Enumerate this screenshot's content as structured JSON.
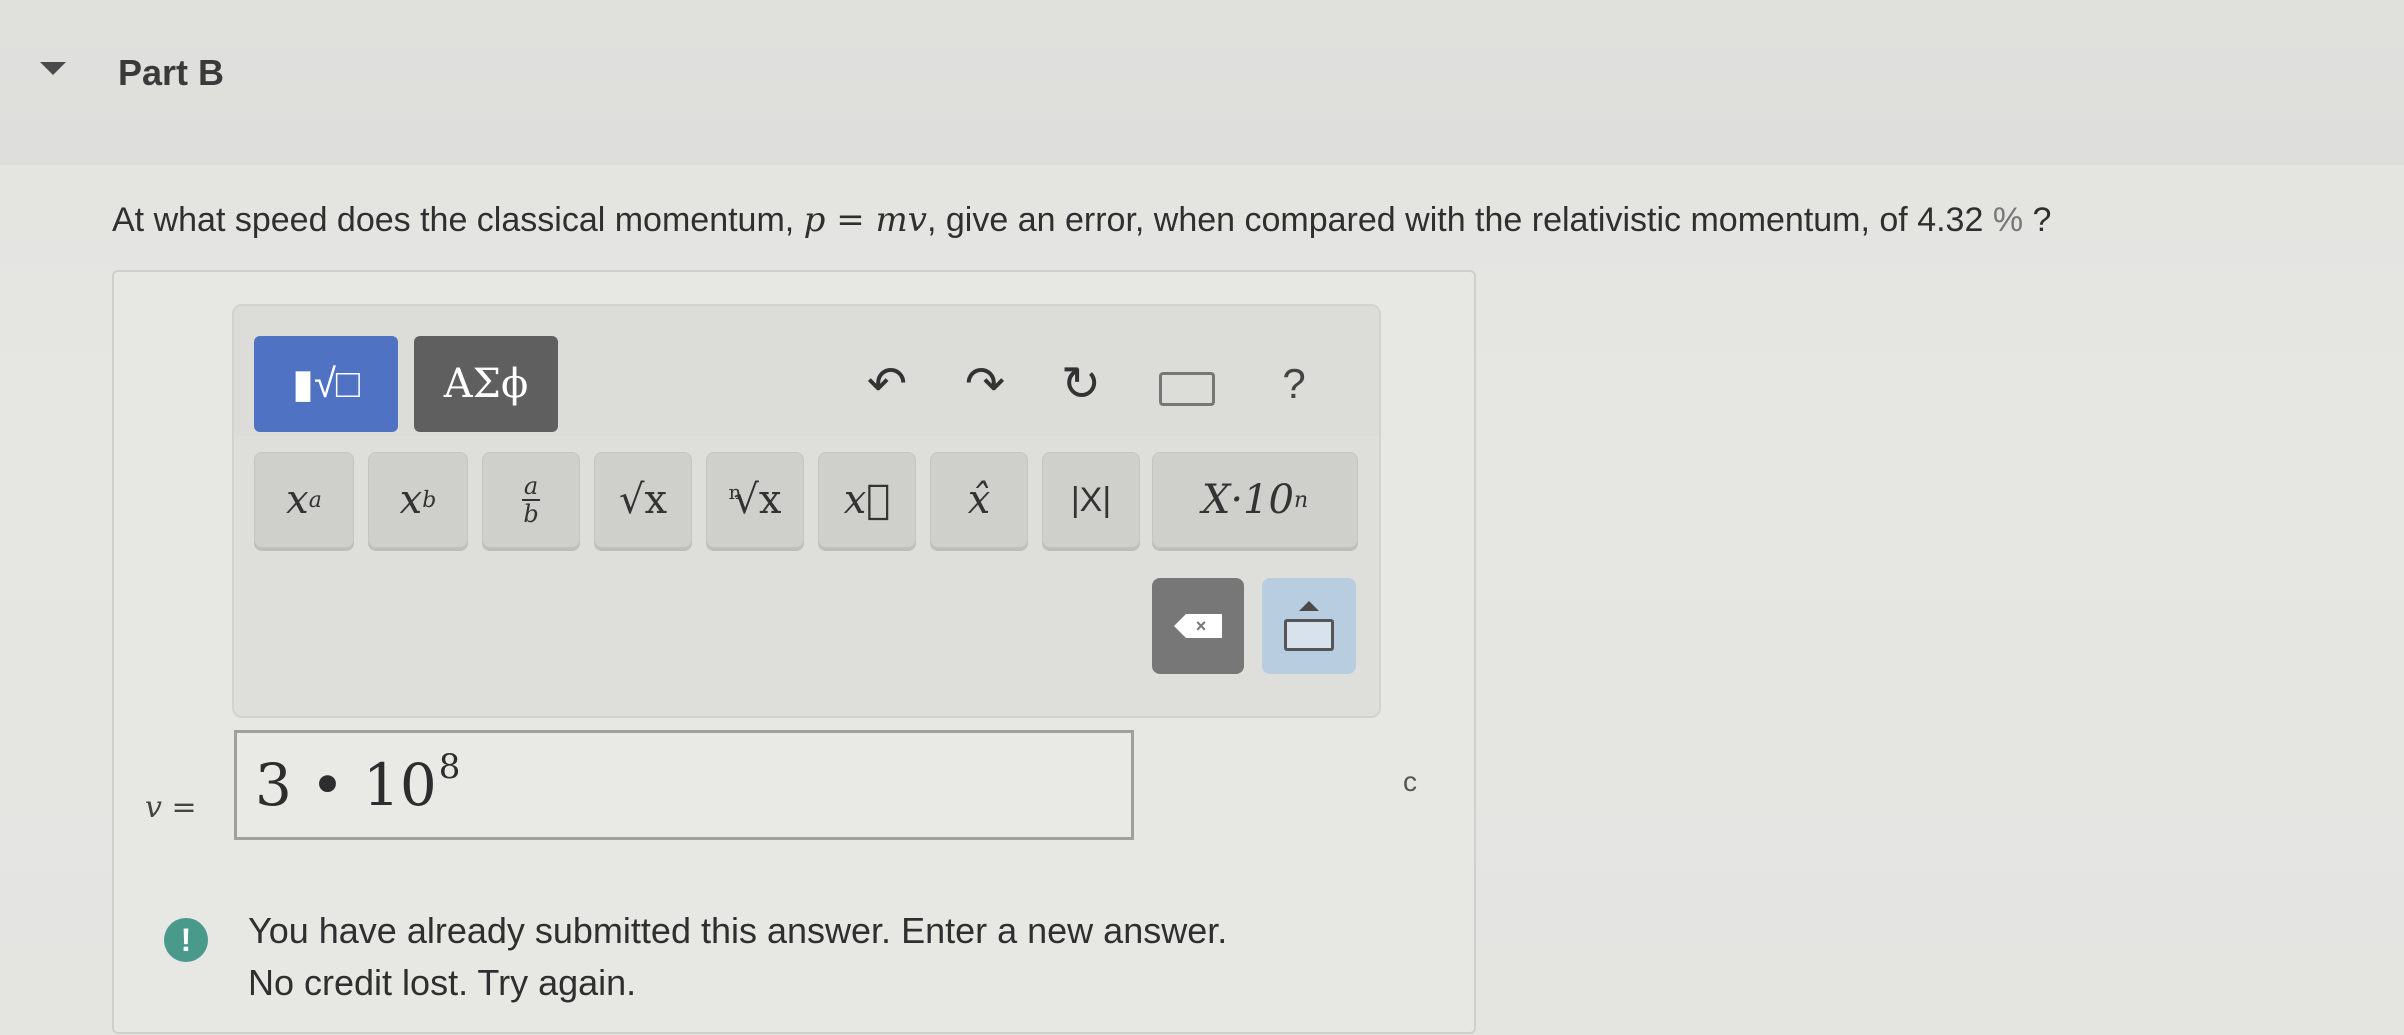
{
  "part": {
    "title": "Part B"
  },
  "question": {
    "prefix": "At what speed does the classical momentum, ",
    "formula": "p = mv",
    "middle": ", give an error, when compared with the relativistic momentum, of ",
    "value": "4.32",
    "percent": "%",
    "suffix": " ?"
  },
  "editor": {
    "tabs": [
      {
        "label": "▮√□",
        "icon": "templates-icon",
        "active": true
      },
      {
        "label": "ΑΣϕ",
        "icon": "greek-symbols-icon",
        "active": false
      }
    ],
    "tools": {
      "undo": "↶",
      "redo": "↷",
      "reset": "↻",
      "help": "?"
    },
    "keys": [
      {
        "name": "superscript",
        "base": "x",
        "script": "a"
      },
      {
        "name": "subscript",
        "base": "x",
        "script": "b"
      },
      {
        "name": "fraction",
        "num": "a",
        "den": "b"
      },
      {
        "name": "square-root",
        "label": "√x"
      },
      {
        "name": "nth-root",
        "index": "n",
        "label": "√x"
      },
      {
        "name": "vector",
        "label": "x⃗"
      },
      {
        "name": "unit-vector",
        "label": "x̂"
      },
      {
        "name": "absolute-value",
        "label": "|X|"
      },
      {
        "name": "scientific-notation",
        "label": "X·10",
        "exp": "n"
      }
    ]
  },
  "answer": {
    "variable": "v",
    "equals": "=",
    "base": "3 • 10",
    "exponent": "8",
    "unit": "c"
  },
  "feedback": {
    "icon": "!",
    "line1": "You have already submitted this answer. Enter a new answer.",
    "line2": "No credit lost. Try again."
  },
  "colors": {
    "templates_tab": "#4f73c2",
    "symbols_tab": "#5f5f5f",
    "alert": "#4a9a8c"
  }
}
